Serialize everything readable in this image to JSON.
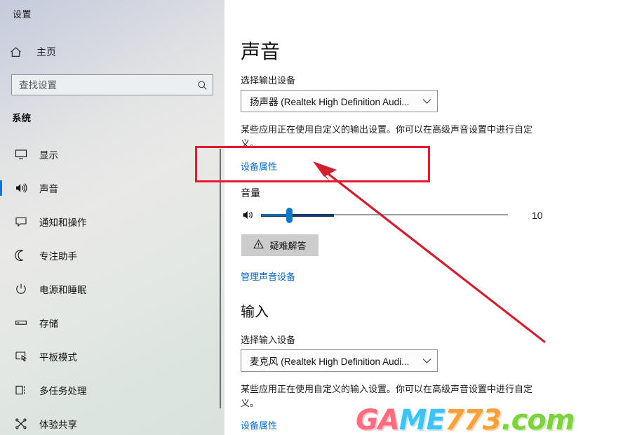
{
  "window": {
    "title": "设置",
    "controls": {
      "minimize": "minimize-icon",
      "maximize": "maximize-icon",
      "close": "close-icon"
    }
  },
  "sidebar": {
    "home_label": "主页",
    "home_icon": "home-icon",
    "search": {
      "placeholder": "查找设置",
      "value": "",
      "icon": "search-icon"
    },
    "group_label": "系统",
    "items": [
      {
        "label": "显示",
        "icon": "monitor-icon",
        "active": false
      },
      {
        "label": "声音",
        "icon": "speaker-icon",
        "active": true
      },
      {
        "label": "通知和操作",
        "icon": "notification-icon",
        "active": false
      },
      {
        "label": "专注助手",
        "icon": "moon-icon",
        "active": false
      },
      {
        "label": "电源和睡眠",
        "icon": "power-icon",
        "active": false
      },
      {
        "label": "存储",
        "icon": "drive-icon",
        "active": false
      },
      {
        "label": "平板模式",
        "icon": "tablet-icon",
        "active": false
      },
      {
        "label": "多任务处理",
        "icon": "multitask-icon",
        "active": false
      },
      {
        "label": "体验共享",
        "icon": "share-icon",
        "active": false
      }
    ]
  },
  "main": {
    "page_title": "声音",
    "output": {
      "choose_label": "选择输出设备",
      "device_value": "扬声器 (Realtek High Definition Audi...",
      "dropdown_icon": "chevron-down-icon",
      "description": "某些应用正在使用自定义的输出设置。你可以在高级声音设置中进行自定义。",
      "device_properties_link": "设备属性",
      "volume_heading": "音量",
      "volume_icon": "speaker-icon",
      "volume_value": "10",
      "troubleshoot_label": "疑难解答",
      "troubleshoot_icon": "warning-icon",
      "manage_devices_link": "管理声音设备"
    },
    "input": {
      "heading": "输入",
      "choose_label": "选择输入设备",
      "device_value": "麦克风 (Realtek High Definition Audi...",
      "dropdown_icon": "chevron-down-icon",
      "description": "某些应用正在使用自定义的输入设置。你可以在高级声音设置中进行自定义。",
      "device_properties_link": "设备属性"
    }
  },
  "annotation": {
    "color": "#e8192c",
    "highlight_target": "设备属性"
  },
  "watermark": {
    "part1": "GAME",
    "part1a": "GA",
    "part1b": "ME",
    "part2": "773",
    "part3": ".com"
  }
}
